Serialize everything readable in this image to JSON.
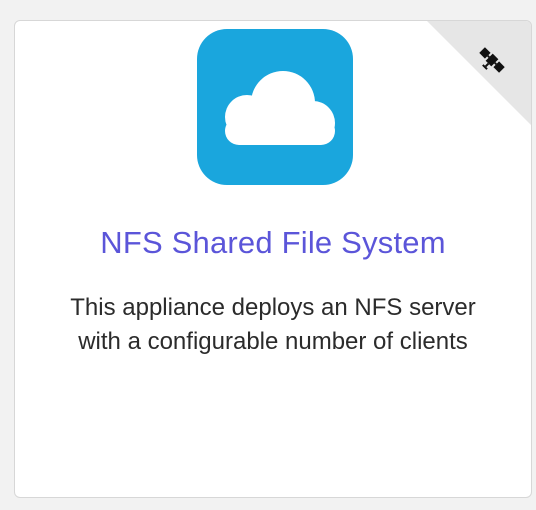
{
  "card": {
    "title": "NFS Shared File System",
    "description": "This appliance deploys an NFS server with a configurable number of clients",
    "app_icon": "cloud-icon",
    "corner_icon": "satellite-icon"
  },
  "colors": {
    "app_icon_bg": "#1aa6dd",
    "title": "#5b55d9",
    "corner_bg": "#e6e6e6"
  }
}
